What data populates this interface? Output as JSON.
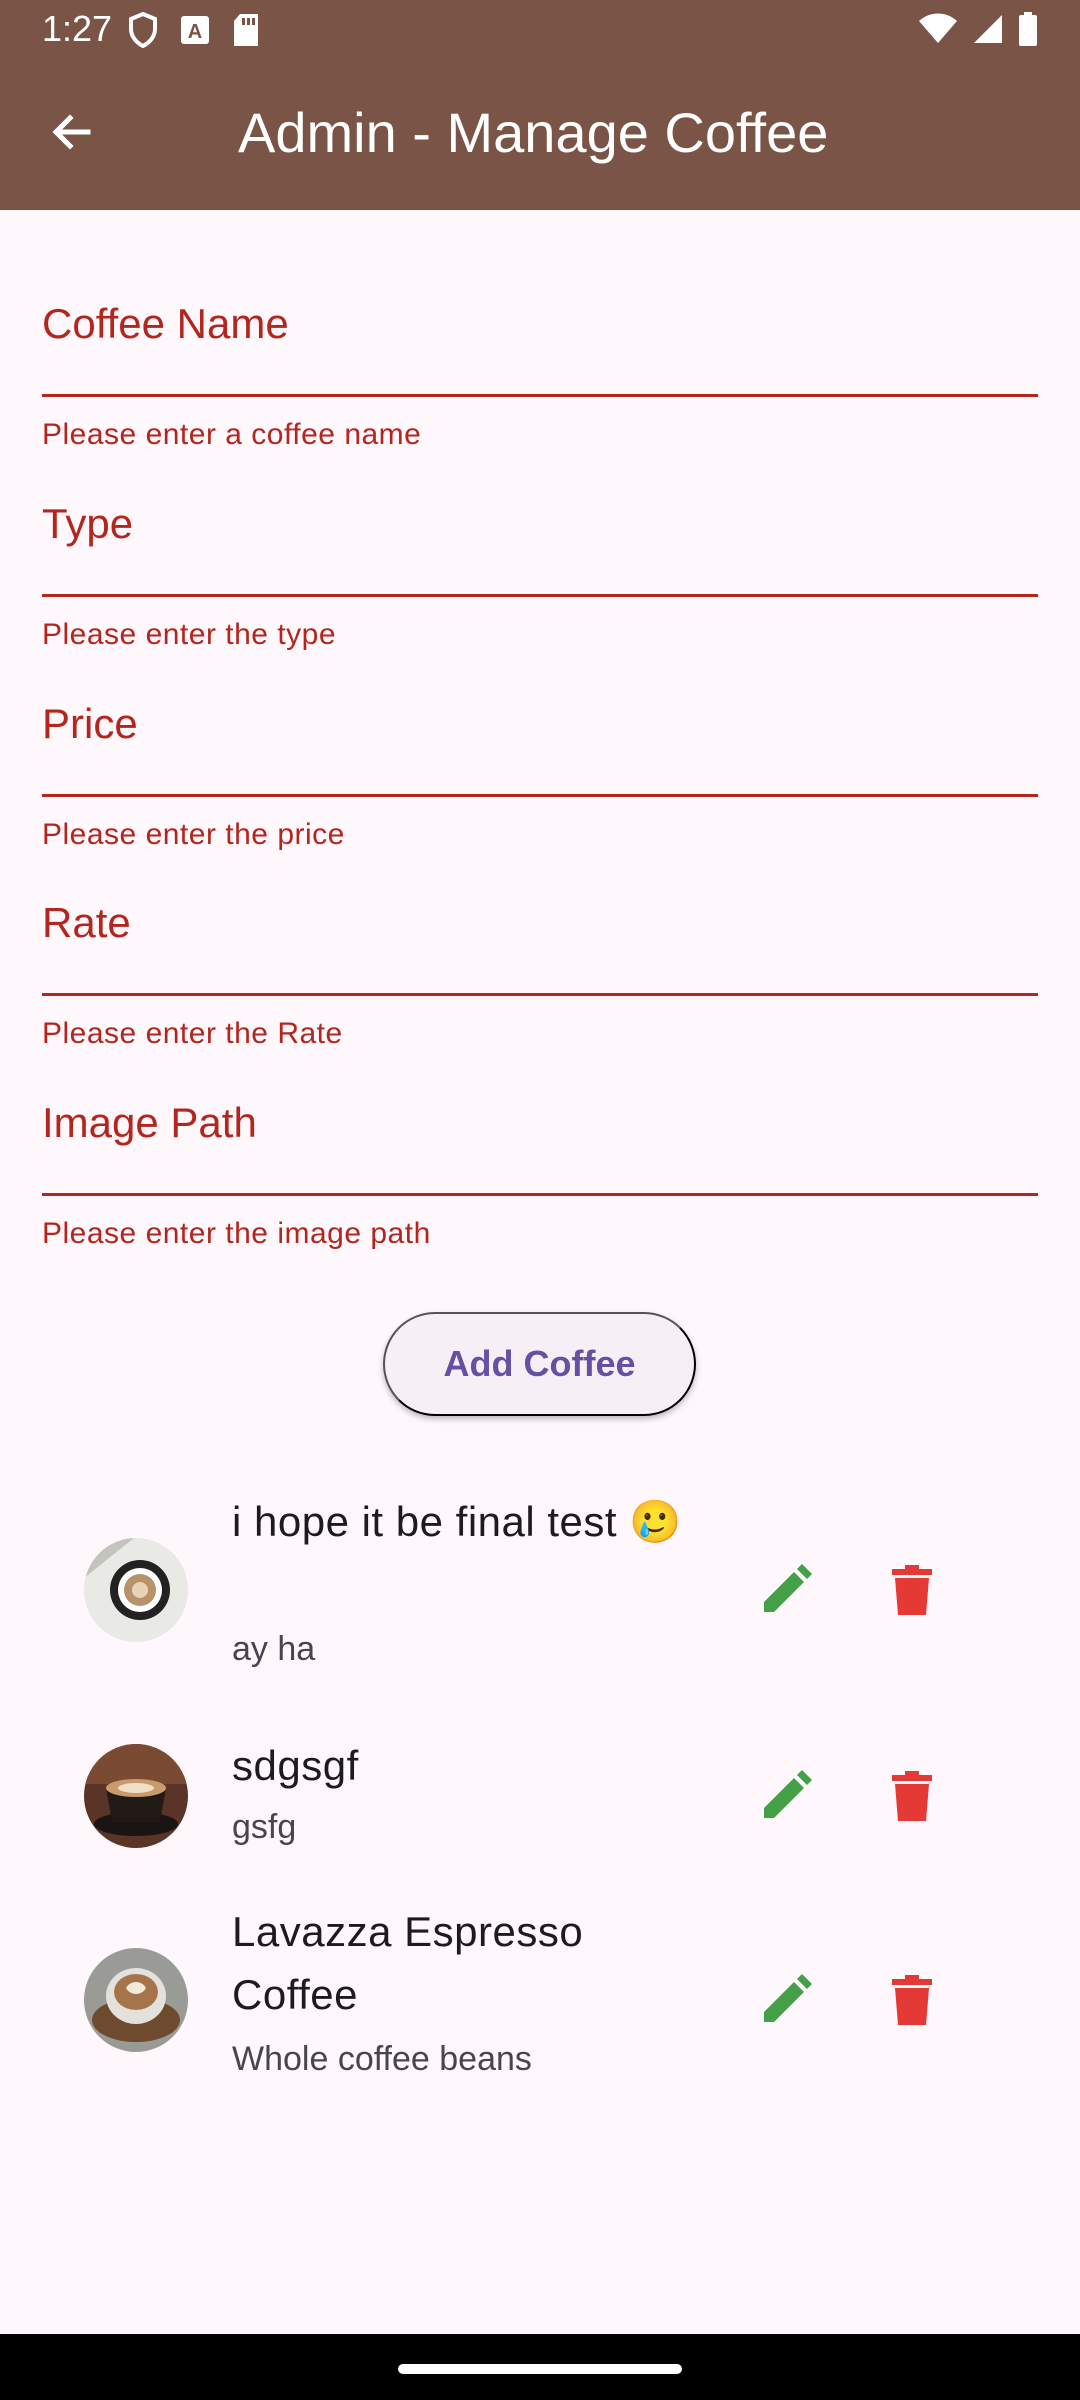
{
  "status_bar": {
    "time": "1:27"
  },
  "app_bar": {
    "title": "Admin - Manage Coffee"
  },
  "form": {
    "fields": [
      {
        "label": "Coffee Name",
        "value": "",
        "error": "Please enter a coffee name"
      },
      {
        "label": "Type",
        "value": "",
        "error": "Please enter the type"
      },
      {
        "label": "Price",
        "value": "",
        "error": "Please enter the price"
      },
      {
        "label": "Rate",
        "value": "",
        "error": "Please enter the Rate"
      },
      {
        "label": "Image Path",
        "value": "",
        "error": "Please enter the image path"
      }
    ],
    "submit_label": "Add Coffee"
  },
  "coffees": [
    {
      "title": "i hope it be final test 🥲",
      "subtitle": "ay ha"
    },
    {
      "title": "sdgsgf",
      "subtitle": "gsfg"
    },
    {
      "title": "Lavazza Espresso Coffee",
      "subtitle": "Whole coffee beans"
    }
  ],
  "colors": {
    "app_bar": "#7a5547",
    "error": "#b3261e",
    "edit_icon": "#43a047",
    "delete_icon": "#e53935",
    "button_text": "#6650a4"
  },
  "icons": {
    "back": "arrow-left-icon",
    "edit": "pencil-icon",
    "delete": "trash-icon"
  }
}
